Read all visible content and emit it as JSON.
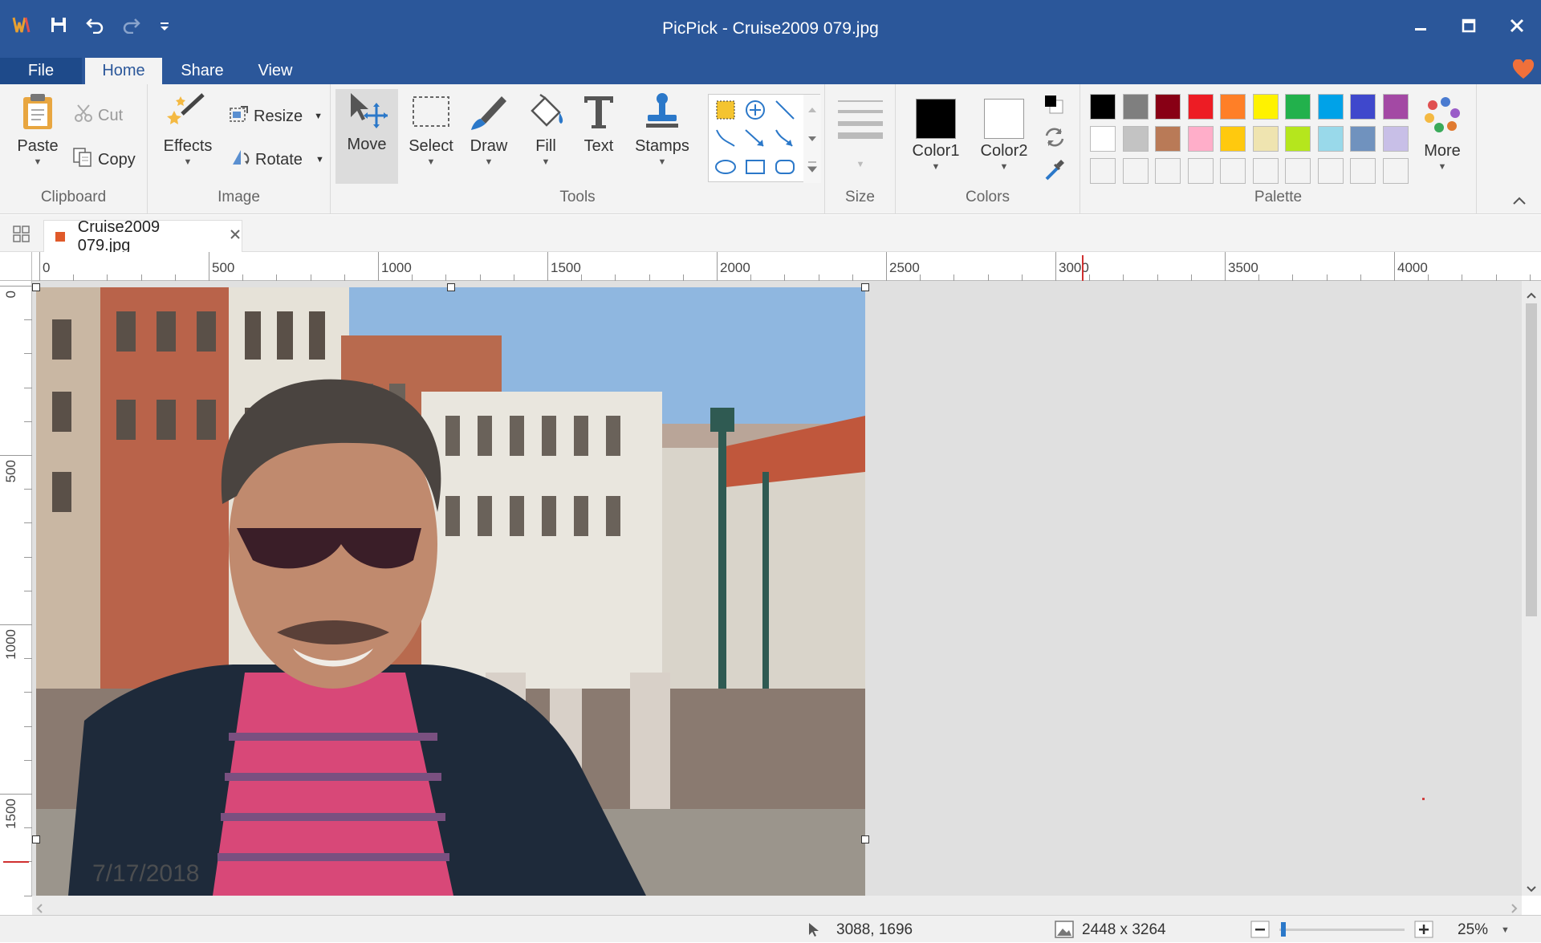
{
  "window": {
    "title": "PicPick - Cruise2009 079.jpg"
  },
  "menu_tabs": [
    {
      "label": "File"
    },
    {
      "label": "Home"
    },
    {
      "label": "Share"
    },
    {
      "label": "View"
    }
  ],
  "ribbon": {
    "clipboard": {
      "label": "Clipboard",
      "paste": "Paste",
      "cut": "Cut",
      "copy": "Copy"
    },
    "image": {
      "label": "Image",
      "effects": "Effects",
      "resize": "Resize",
      "rotate": "Rotate"
    },
    "tools": {
      "label": "Tools",
      "move": "Move",
      "select": "Select",
      "draw": "Draw",
      "fill": "Fill",
      "text": "Text",
      "stamps": "Stamps"
    },
    "size": {
      "label": "Size"
    },
    "colors": {
      "label": "Colors",
      "color1": "Color1",
      "color2": "Color2",
      "color1_value": "#000000",
      "color2_value": "#ffffff"
    },
    "palette": {
      "label": "Palette",
      "more": "More",
      "row1": [
        "#000000",
        "#7f7f7f",
        "#880015",
        "#ed1c24",
        "#ff7f27",
        "#fff200",
        "#22b14c",
        "#00a2e8",
        "#3f48cc",
        "#a349a4"
      ],
      "row2": [
        "#ffffff",
        "#c3c3c3",
        "#b97a57",
        "#ffaec9",
        "#ffc90e",
        "#efe4b0",
        "#b5e61d",
        "#99d9ea",
        "#7092be",
        "#c8bfe7"
      ]
    }
  },
  "document_tab": {
    "name": "Cruise2009 079.jpg"
  },
  "ruler_h": [
    "0",
    "500",
    "1000",
    "1500",
    "2000",
    "2500",
    "3000",
    "3500",
    "4000"
  ],
  "ruler_v": [
    "0",
    "500",
    "1000",
    "1500"
  ],
  "photo": {
    "date_stamp": "7/17/2018"
  },
  "status": {
    "cursor_pos": "3088, 1696",
    "image_size": "2448 x 3264",
    "zoom": "25%"
  },
  "accent_color": "#2b579a"
}
